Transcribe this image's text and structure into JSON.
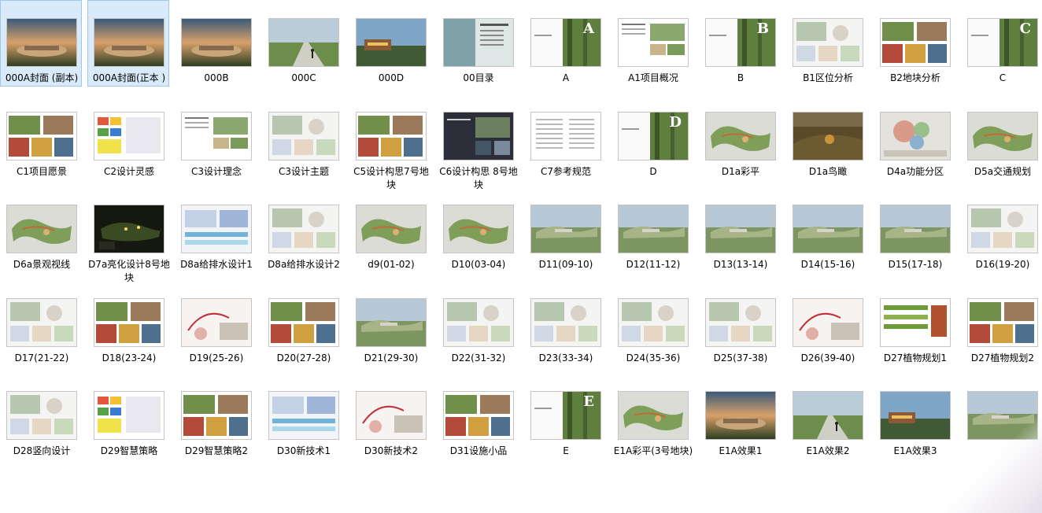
{
  "files": [
    {
      "label": "000A封面 (副本)",
      "thumb": "aerial",
      "selected": true
    },
    {
      "label": "000A封面(正本 )",
      "thumb": "aerial",
      "selected": true
    },
    {
      "label": "000B",
      "thumb": "aerial"
    },
    {
      "label": "000C",
      "thumb": "path"
    },
    {
      "label": "000D",
      "thumb": "building"
    },
    {
      "label": "00目录",
      "thumb": "contents"
    },
    {
      "label": "A",
      "thumb": "section",
      "letter": "A"
    },
    {
      "label": "A1项目概况",
      "thumb": "doc"
    },
    {
      "label": "B",
      "thumb": "section",
      "letter": "B"
    },
    {
      "label": "B1区位分析",
      "thumb": "diagram"
    },
    {
      "label": "B2地块分析",
      "thumb": "collage"
    },
    {
      "label": "C",
      "thumb": "section",
      "letter": "C"
    },
    {
      "label": "C1项目愿景",
      "thumb": "collage"
    },
    {
      "label": "C2设计灵感",
      "thumb": "colorful"
    },
    {
      "label": "C3设计理念",
      "thumb": "doc"
    },
    {
      "label": "C3设计主题",
      "thumb": "diagram"
    },
    {
      "label": "C5设计构思7号地块",
      "thumb": "collage"
    },
    {
      "label": "C6设计构思 8号地块",
      "thumb": "dark"
    },
    {
      "label": "C7参考规范",
      "thumb": "text"
    },
    {
      "label": "D",
      "thumb": "section",
      "letter": "D"
    },
    {
      "label": "D1a彩平",
      "thumb": "plan"
    },
    {
      "label": "D1a鸟瞰",
      "thumb": "birdseye"
    },
    {
      "label": "D4a功能分区",
      "thumb": "zoning"
    },
    {
      "label": "D5a交通规划",
      "thumb": "plan"
    },
    {
      "label": "D6a景观视线",
      "thumb": "plan"
    },
    {
      "label": "D7a亮化设计8号地块",
      "thumb": "night"
    },
    {
      "label": "D8a给排水设计1",
      "thumb": "blue"
    },
    {
      "label": "D8a给排水设计2",
      "thumb": "diagram"
    },
    {
      "label": "d9(01-02)",
      "thumb": "plan"
    },
    {
      "label": "D10(03-04)",
      "thumb": "plan"
    },
    {
      "label": "D11(09-10)",
      "thumb": "render"
    },
    {
      "label": "D12(11-12)",
      "thumb": "render"
    },
    {
      "label": "D13(13-14)",
      "thumb": "render"
    },
    {
      "label": "D14(15-16)",
      "thumb": "render"
    },
    {
      "label": "D15(17-18)",
      "thumb": "render"
    },
    {
      "label": "D16(19-20)",
      "thumb": "diagram"
    },
    {
      "label": "D17(21-22)",
      "thumb": "diagram"
    },
    {
      "label": "D18(23-24)",
      "thumb": "collage"
    },
    {
      "label": "D19(25-26)",
      "thumb": "red"
    },
    {
      "label": "D20(27-28)",
      "thumb": "collage"
    },
    {
      "label": "D21(29-30)",
      "thumb": "render"
    },
    {
      "label": "D22(31-32)",
      "thumb": "diagram"
    },
    {
      "label": "D23(33-34)",
      "thumb": "diagram"
    },
    {
      "label": "D24(35-36)",
      "thumb": "diagram"
    },
    {
      "label": "D25(37-38)",
      "thumb": "diagram"
    },
    {
      "label": "D26(39-40)",
      "thumb": "red"
    },
    {
      "label": "D27植物规划1",
      "thumb": "green"
    },
    {
      "label": "D27植物规划2",
      "thumb": "collage"
    },
    {
      "label": "D28竖向设计",
      "thumb": "diagram"
    },
    {
      "label": "D29智慧策略",
      "thumb": "colorful"
    },
    {
      "label": "D29智慧策略2",
      "thumb": "collage"
    },
    {
      "label": "D30新技术1",
      "thumb": "blue"
    },
    {
      "label": "D30新技术2",
      "thumb": "red"
    },
    {
      "label": "D31设施小品",
      "thumb": "collage"
    },
    {
      "label": "E",
      "thumb": "section",
      "letter": "E"
    },
    {
      "label": "E1A彩平(3号地块)",
      "thumb": "plan"
    },
    {
      "label": "E1A效果1",
      "thumb": "aerial"
    },
    {
      "label": "E1A效果2",
      "thumb": "path"
    },
    {
      "label": "E1A效果3",
      "thumb": "building"
    },
    {
      "label": "",
      "thumb": "render"
    }
  ],
  "colors": {
    "selection_bg": "#d9ebfb",
    "selection_border": "#9cc7ee",
    "thumb_border": "#c4c4c4",
    "text": "#000000"
  }
}
